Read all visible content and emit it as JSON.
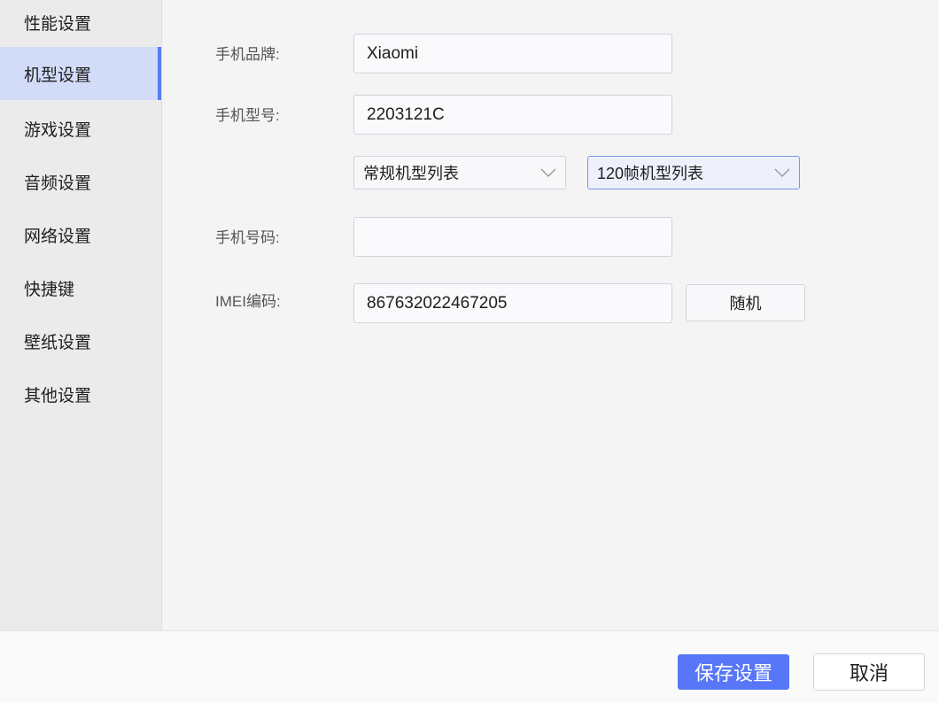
{
  "sidebar": {
    "items": [
      {
        "label": "性能设置",
        "active": false
      },
      {
        "label": "机型设置",
        "active": true
      },
      {
        "label": "游戏设置",
        "active": false
      },
      {
        "label": "音频设置",
        "active": false
      },
      {
        "label": "网络设置",
        "active": false
      },
      {
        "label": "快捷键",
        "active": false
      },
      {
        "label": "壁纸设置",
        "active": false
      },
      {
        "label": "其他设置",
        "active": false
      }
    ]
  },
  "form": {
    "brand_label": "手机品牌:",
    "brand_value": "Xiaomi",
    "model_label": "手机型号:",
    "model_value": "2203121C",
    "regular_models_select": "常规机型列表",
    "fps120_models_select": "120帧机型列表",
    "phone_label": "手机号码:",
    "phone_value": "",
    "imei_label": "IMEI编码:",
    "imei_value": "867632022467205",
    "random_button": "随机"
  },
  "footer": {
    "save_label": "保存设置",
    "cancel_label": "取消"
  },
  "colors": {
    "accent": "#5877f8",
    "active_nav_bg": "#d2dbf7",
    "active_nav_border": "#5a7bf0"
  },
  "icons": {
    "select_arrow": "chevron-down-icon"
  }
}
